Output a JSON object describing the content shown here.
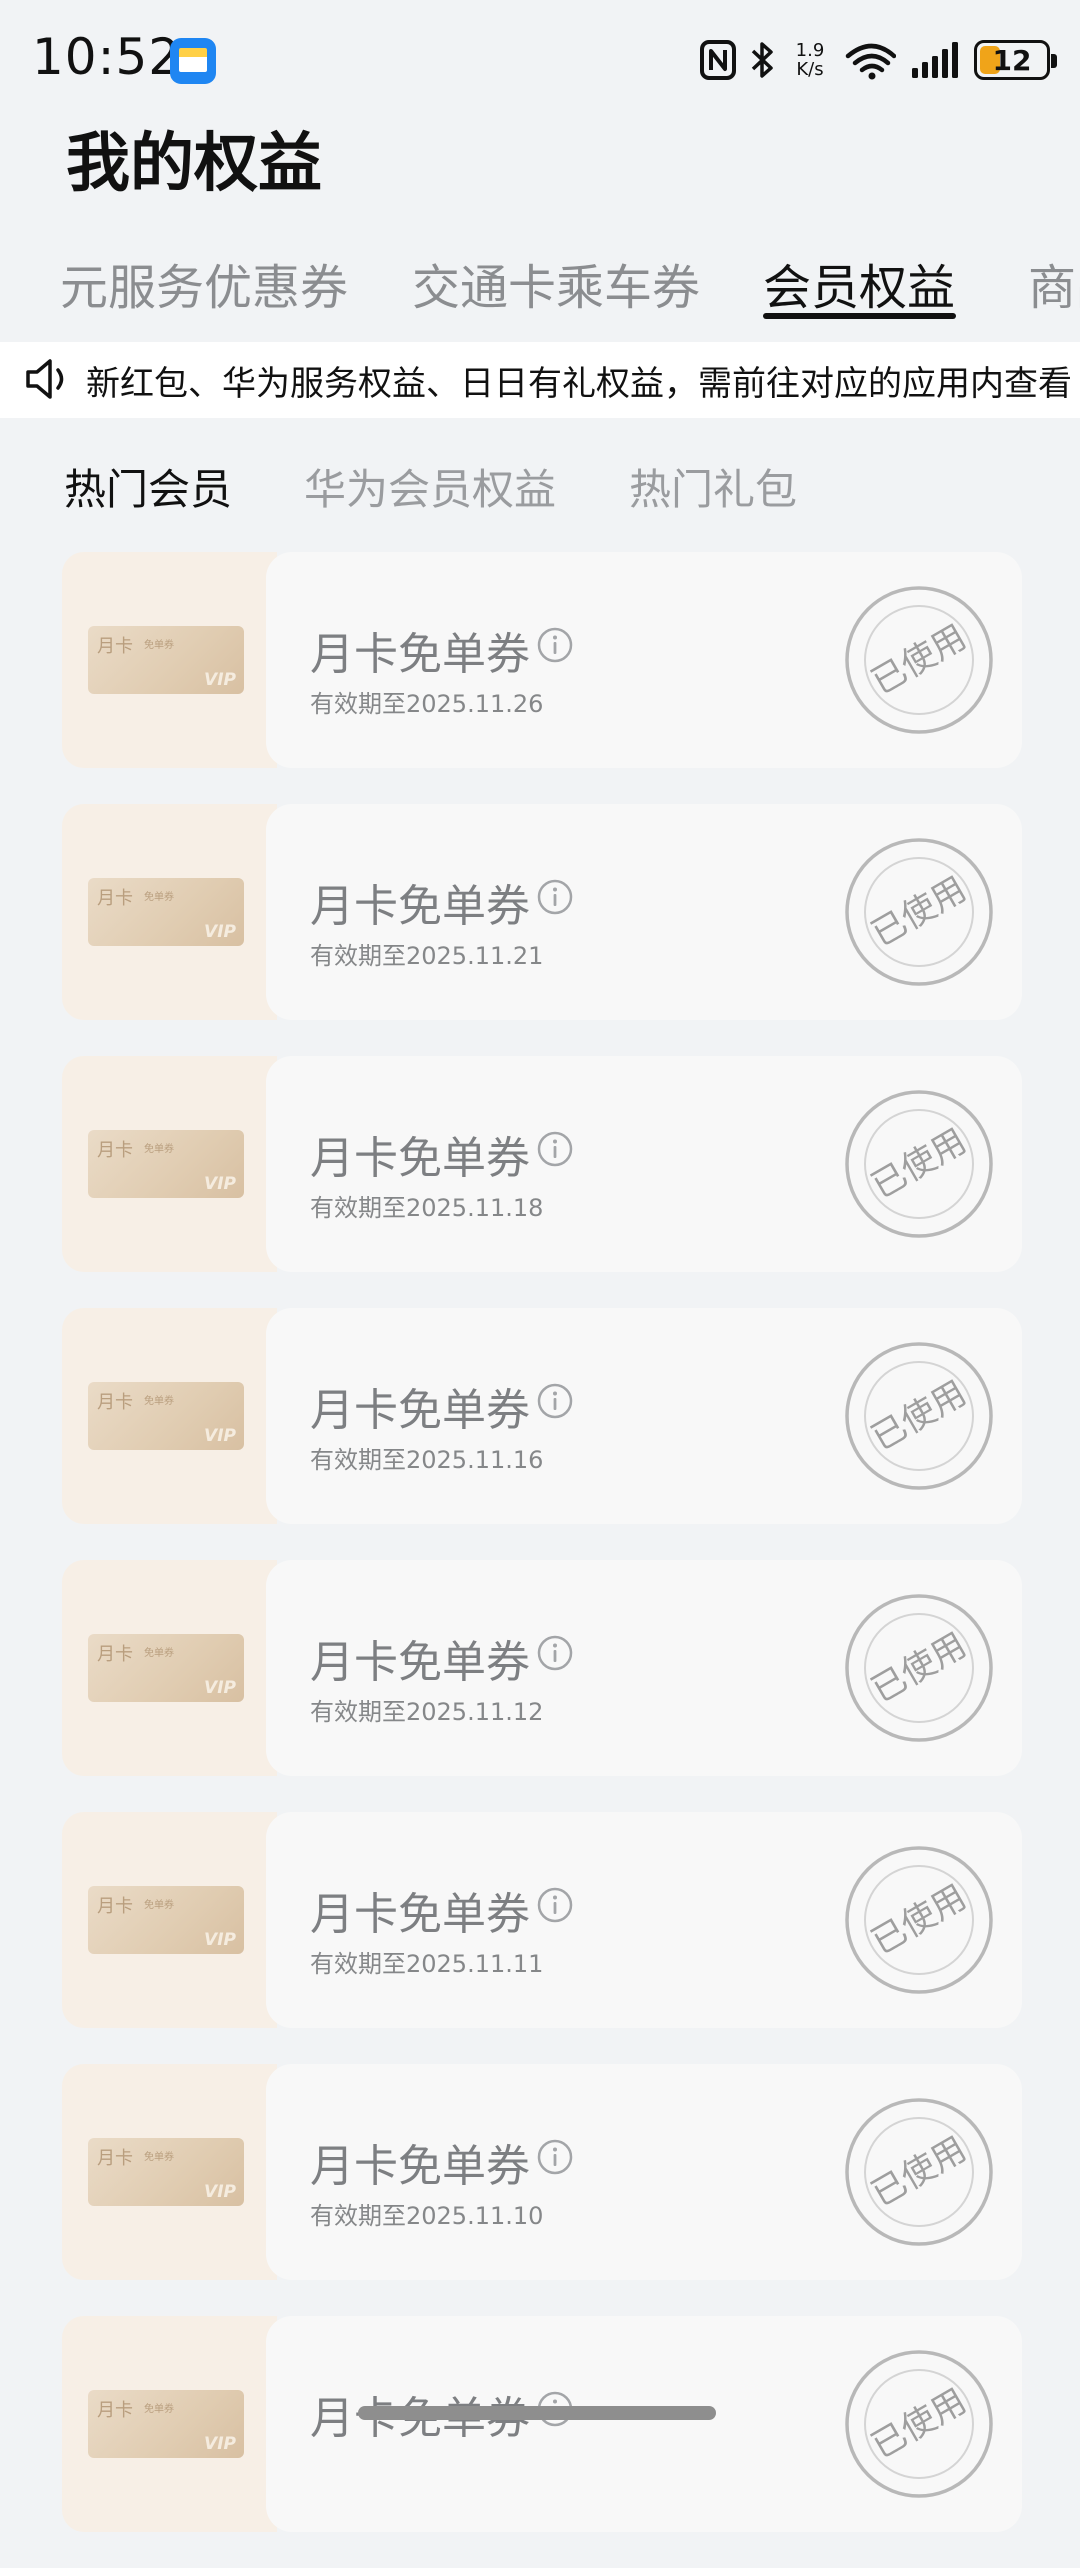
{
  "status_bar": {
    "time": "10:52",
    "net_speed_value": "1.9",
    "net_speed_unit": "K/s",
    "battery_level": "12",
    "app_icon": "wallet-icon",
    "icons": [
      "nfc-icon",
      "bluetooth-icon",
      "wifi-6-icon",
      "signal-icon",
      "battery-icon"
    ]
  },
  "page": {
    "title": "我的权益"
  },
  "main_tabs": [
    {
      "label": "元服务优惠券",
      "active": false
    },
    {
      "label": "交通卡乘车券",
      "active": false
    },
    {
      "label": "会员权益",
      "active": true
    },
    {
      "label": "商品",
      "active": false
    }
  ],
  "notice": {
    "icon": "speaker-icon",
    "text": "新红包、华为服务权益、日日有礼权益，需前往对应的应用内查看"
  },
  "sub_tabs": [
    {
      "label": "热门会员",
      "active": true
    },
    {
      "label": "华为会员权益",
      "active": false
    },
    {
      "label": "热门礼包",
      "active": false
    }
  ],
  "coupon_card_art": {
    "title": "月卡",
    "subtitle": "免单券",
    "badge": "VIP"
  },
  "coupons": [
    {
      "name": "月卡免单券",
      "expiry": "有效期至2025.11.26",
      "status": "已使用"
    },
    {
      "name": "月卡免单券",
      "expiry": "有效期至2025.11.21",
      "status": "已使用"
    },
    {
      "name": "月卡免单券",
      "expiry": "有效期至2025.11.18",
      "status": "已使用"
    },
    {
      "name": "月卡免单券",
      "expiry": "有效期至2025.11.16",
      "status": "已使用"
    },
    {
      "name": "月卡免单券",
      "expiry": "有效期至2025.11.12",
      "status": "已使用"
    },
    {
      "name": "月卡免单券",
      "expiry": "有效期至2025.11.11",
      "status": "已使用"
    },
    {
      "name": "月卡免单券",
      "expiry": "有效期至2025.11.10",
      "status": "已使用"
    },
    {
      "name": "月卡免单券",
      "expiry": "",
      "status": "已使用"
    }
  ],
  "colors": {
    "background": "#f1f3f5",
    "coupon_art_bg": "#f7efe6",
    "battery_fill": "#f0a419",
    "stamp": "#b8b8b8"
  }
}
